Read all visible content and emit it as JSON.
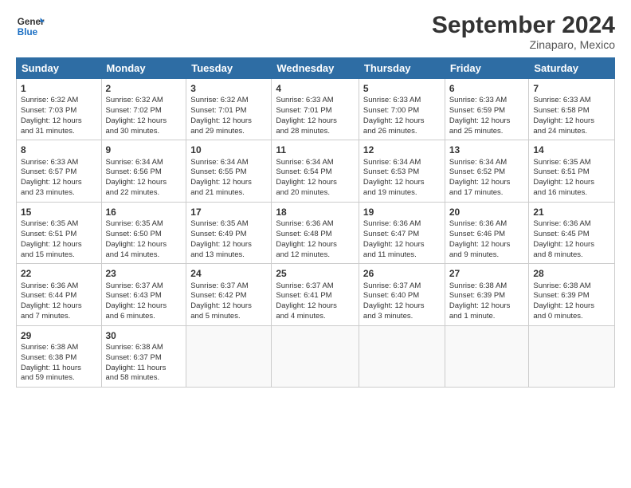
{
  "logo": {
    "line1": "General",
    "line2": "Blue"
  },
  "title": "September 2024",
  "subtitle": "Zinaparo, Mexico",
  "weekdays": [
    "Sunday",
    "Monday",
    "Tuesday",
    "Wednesday",
    "Thursday",
    "Friday",
    "Saturday"
  ],
  "weeks": [
    [
      {
        "day": "1",
        "lines": [
          "Sunrise: 6:32 AM",
          "Sunset: 7:03 PM",
          "Daylight: 12 hours",
          "and 31 minutes."
        ]
      },
      {
        "day": "2",
        "lines": [
          "Sunrise: 6:32 AM",
          "Sunset: 7:02 PM",
          "Daylight: 12 hours",
          "and 30 minutes."
        ]
      },
      {
        "day": "3",
        "lines": [
          "Sunrise: 6:32 AM",
          "Sunset: 7:01 PM",
          "Daylight: 12 hours",
          "and 29 minutes."
        ]
      },
      {
        "day": "4",
        "lines": [
          "Sunrise: 6:33 AM",
          "Sunset: 7:01 PM",
          "Daylight: 12 hours",
          "and 28 minutes."
        ]
      },
      {
        "day": "5",
        "lines": [
          "Sunrise: 6:33 AM",
          "Sunset: 7:00 PM",
          "Daylight: 12 hours",
          "and 26 minutes."
        ]
      },
      {
        "day": "6",
        "lines": [
          "Sunrise: 6:33 AM",
          "Sunset: 6:59 PM",
          "Daylight: 12 hours",
          "and 25 minutes."
        ]
      },
      {
        "day": "7",
        "lines": [
          "Sunrise: 6:33 AM",
          "Sunset: 6:58 PM",
          "Daylight: 12 hours",
          "and 24 minutes."
        ]
      }
    ],
    [
      {
        "day": "8",
        "lines": [
          "Sunrise: 6:33 AM",
          "Sunset: 6:57 PM",
          "Daylight: 12 hours",
          "and 23 minutes."
        ]
      },
      {
        "day": "9",
        "lines": [
          "Sunrise: 6:34 AM",
          "Sunset: 6:56 PM",
          "Daylight: 12 hours",
          "and 22 minutes."
        ]
      },
      {
        "day": "10",
        "lines": [
          "Sunrise: 6:34 AM",
          "Sunset: 6:55 PM",
          "Daylight: 12 hours",
          "and 21 minutes."
        ]
      },
      {
        "day": "11",
        "lines": [
          "Sunrise: 6:34 AM",
          "Sunset: 6:54 PM",
          "Daylight: 12 hours",
          "and 20 minutes."
        ]
      },
      {
        "day": "12",
        "lines": [
          "Sunrise: 6:34 AM",
          "Sunset: 6:53 PM",
          "Daylight: 12 hours",
          "and 19 minutes."
        ]
      },
      {
        "day": "13",
        "lines": [
          "Sunrise: 6:34 AM",
          "Sunset: 6:52 PM",
          "Daylight: 12 hours",
          "and 17 minutes."
        ]
      },
      {
        "day": "14",
        "lines": [
          "Sunrise: 6:35 AM",
          "Sunset: 6:51 PM",
          "Daylight: 12 hours",
          "and 16 minutes."
        ]
      }
    ],
    [
      {
        "day": "15",
        "lines": [
          "Sunrise: 6:35 AM",
          "Sunset: 6:51 PM",
          "Daylight: 12 hours",
          "and 15 minutes."
        ]
      },
      {
        "day": "16",
        "lines": [
          "Sunrise: 6:35 AM",
          "Sunset: 6:50 PM",
          "Daylight: 12 hours",
          "and 14 minutes."
        ]
      },
      {
        "day": "17",
        "lines": [
          "Sunrise: 6:35 AM",
          "Sunset: 6:49 PM",
          "Daylight: 12 hours",
          "and 13 minutes."
        ]
      },
      {
        "day": "18",
        "lines": [
          "Sunrise: 6:36 AM",
          "Sunset: 6:48 PM",
          "Daylight: 12 hours",
          "and 12 minutes."
        ]
      },
      {
        "day": "19",
        "lines": [
          "Sunrise: 6:36 AM",
          "Sunset: 6:47 PM",
          "Daylight: 12 hours",
          "and 11 minutes."
        ]
      },
      {
        "day": "20",
        "lines": [
          "Sunrise: 6:36 AM",
          "Sunset: 6:46 PM",
          "Daylight: 12 hours",
          "and 9 minutes."
        ]
      },
      {
        "day": "21",
        "lines": [
          "Sunrise: 6:36 AM",
          "Sunset: 6:45 PM",
          "Daylight: 12 hours",
          "and 8 minutes."
        ]
      }
    ],
    [
      {
        "day": "22",
        "lines": [
          "Sunrise: 6:36 AM",
          "Sunset: 6:44 PM",
          "Daylight: 12 hours",
          "and 7 minutes."
        ]
      },
      {
        "day": "23",
        "lines": [
          "Sunrise: 6:37 AM",
          "Sunset: 6:43 PM",
          "Daylight: 12 hours",
          "and 6 minutes."
        ]
      },
      {
        "day": "24",
        "lines": [
          "Sunrise: 6:37 AM",
          "Sunset: 6:42 PM",
          "Daylight: 12 hours",
          "and 5 minutes."
        ]
      },
      {
        "day": "25",
        "lines": [
          "Sunrise: 6:37 AM",
          "Sunset: 6:41 PM",
          "Daylight: 12 hours",
          "and 4 minutes."
        ]
      },
      {
        "day": "26",
        "lines": [
          "Sunrise: 6:37 AM",
          "Sunset: 6:40 PM",
          "Daylight: 12 hours",
          "and 3 minutes."
        ]
      },
      {
        "day": "27",
        "lines": [
          "Sunrise: 6:38 AM",
          "Sunset: 6:39 PM",
          "Daylight: 12 hours",
          "and 1 minute."
        ]
      },
      {
        "day": "28",
        "lines": [
          "Sunrise: 6:38 AM",
          "Sunset: 6:39 PM",
          "Daylight: 12 hours",
          "and 0 minutes."
        ]
      }
    ],
    [
      {
        "day": "29",
        "lines": [
          "Sunrise: 6:38 AM",
          "Sunset: 6:38 PM",
          "Daylight: 11 hours",
          "and 59 minutes."
        ]
      },
      {
        "day": "30",
        "lines": [
          "Sunrise: 6:38 AM",
          "Sunset: 6:37 PM",
          "Daylight: 11 hours",
          "and 58 minutes."
        ]
      },
      {
        "day": "",
        "lines": []
      },
      {
        "day": "",
        "lines": []
      },
      {
        "day": "",
        "lines": []
      },
      {
        "day": "",
        "lines": []
      },
      {
        "day": "",
        "lines": []
      }
    ]
  ]
}
